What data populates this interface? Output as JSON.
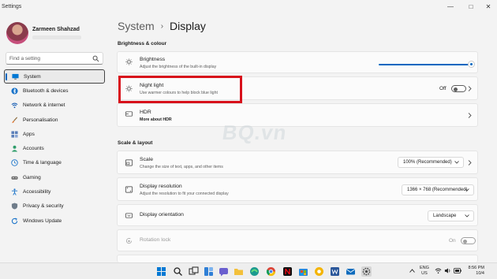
{
  "window": {
    "app_title": "Settings",
    "controls": [
      "—",
      "□",
      "✕"
    ]
  },
  "profile": {
    "name": "Zarmeen Shahzad"
  },
  "search": {
    "placeholder": "Find a setting"
  },
  "sidebar": {
    "items": [
      {
        "label": "System",
        "icon": "monitor-icon",
        "active": true
      },
      {
        "label": "Bluetooth & devices",
        "icon": "bluetooth-icon"
      },
      {
        "label": "Network & internet",
        "icon": "wifi-icon"
      },
      {
        "label": "Personalisation",
        "icon": "brush-icon"
      },
      {
        "label": "Apps",
        "icon": "apps-icon"
      },
      {
        "label": "Accounts",
        "icon": "person-icon"
      },
      {
        "label": "Time & language",
        "icon": "globe-clock-icon"
      },
      {
        "label": "Gaming",
        "icon": "controller-icon"
      },
      {
        "label": "Accessibility",
        "icon": "accessibility-icon"
      },
      {
        "label": "Privacy & security",
        "icon": "shield-icon"
      },
      {
        "label": "Windows Update",
        "icon": "update-icon"
      }
    ]
  },
  "breadcrumb": {
    "parent": "System",
    "separator": "›",
    "current": "Display"
  },
  "sections": {
    "brightness": {
      "title": "Brightness & colour",
      "brightness": {
        "title": "Brightness",
        "subtitle": "Adjust the brightness of the built-in display",
        "value_percent": 100
      },
      "night_light": {
        "title": "Night light",
        "subtitle": "Use warmer colours to help block blue light",
        "state": "Off"
      },
      "hdr": {
        "title": "HDR",
        "subtitle": "More about HDR"
      }
    },
    "scale_layout": {
      "title": "Scale & layout",
      "scale": {
        "title": "Scale",
        "subtitle": "Change the size of text, apps, and other items",
        "value": "100% (Recommended)"
      },
      "resolution": {
        "title": "Display resolution",
        "subtitle": "Adjust the resolution to fit your connected display",
        "value": "1366 × 768 (Recommended)"
      },
      "orientation": {
        "title": "Display orientation",
        "value": "Landscape"
      },
      "rotation_lock": {
        "title": "Rotation lock",
        "state": "On"
      }
    }
  },
  "watermark": "BQ.vn",
  "taskbar": {
    "icons": [
      "windows-start-icon",
      "search-icon",
      "task-view-icon",
      "widgets-icon",
      "chat-icon",
      "file-explorer-icon",
      "edge-icon",
      "chrome-icon",
      "netflix-icon",
      "ms-store-icon",
      "chrome-canary-icon",
      "word-icon",
      "mail-icon",
      "settings-icon"
    ],
    "language": {
      "line1": "ENG",
      "line2": "US"
    },
    "time": "8:56 PM",
    "date": "10/4"
  },
  "colors": {
    "accent": "#0067c0",
    "highlight": "#d8111b",
    "background": "#f3f3f3",
    "card": "#fbfbfb"
  }
}
